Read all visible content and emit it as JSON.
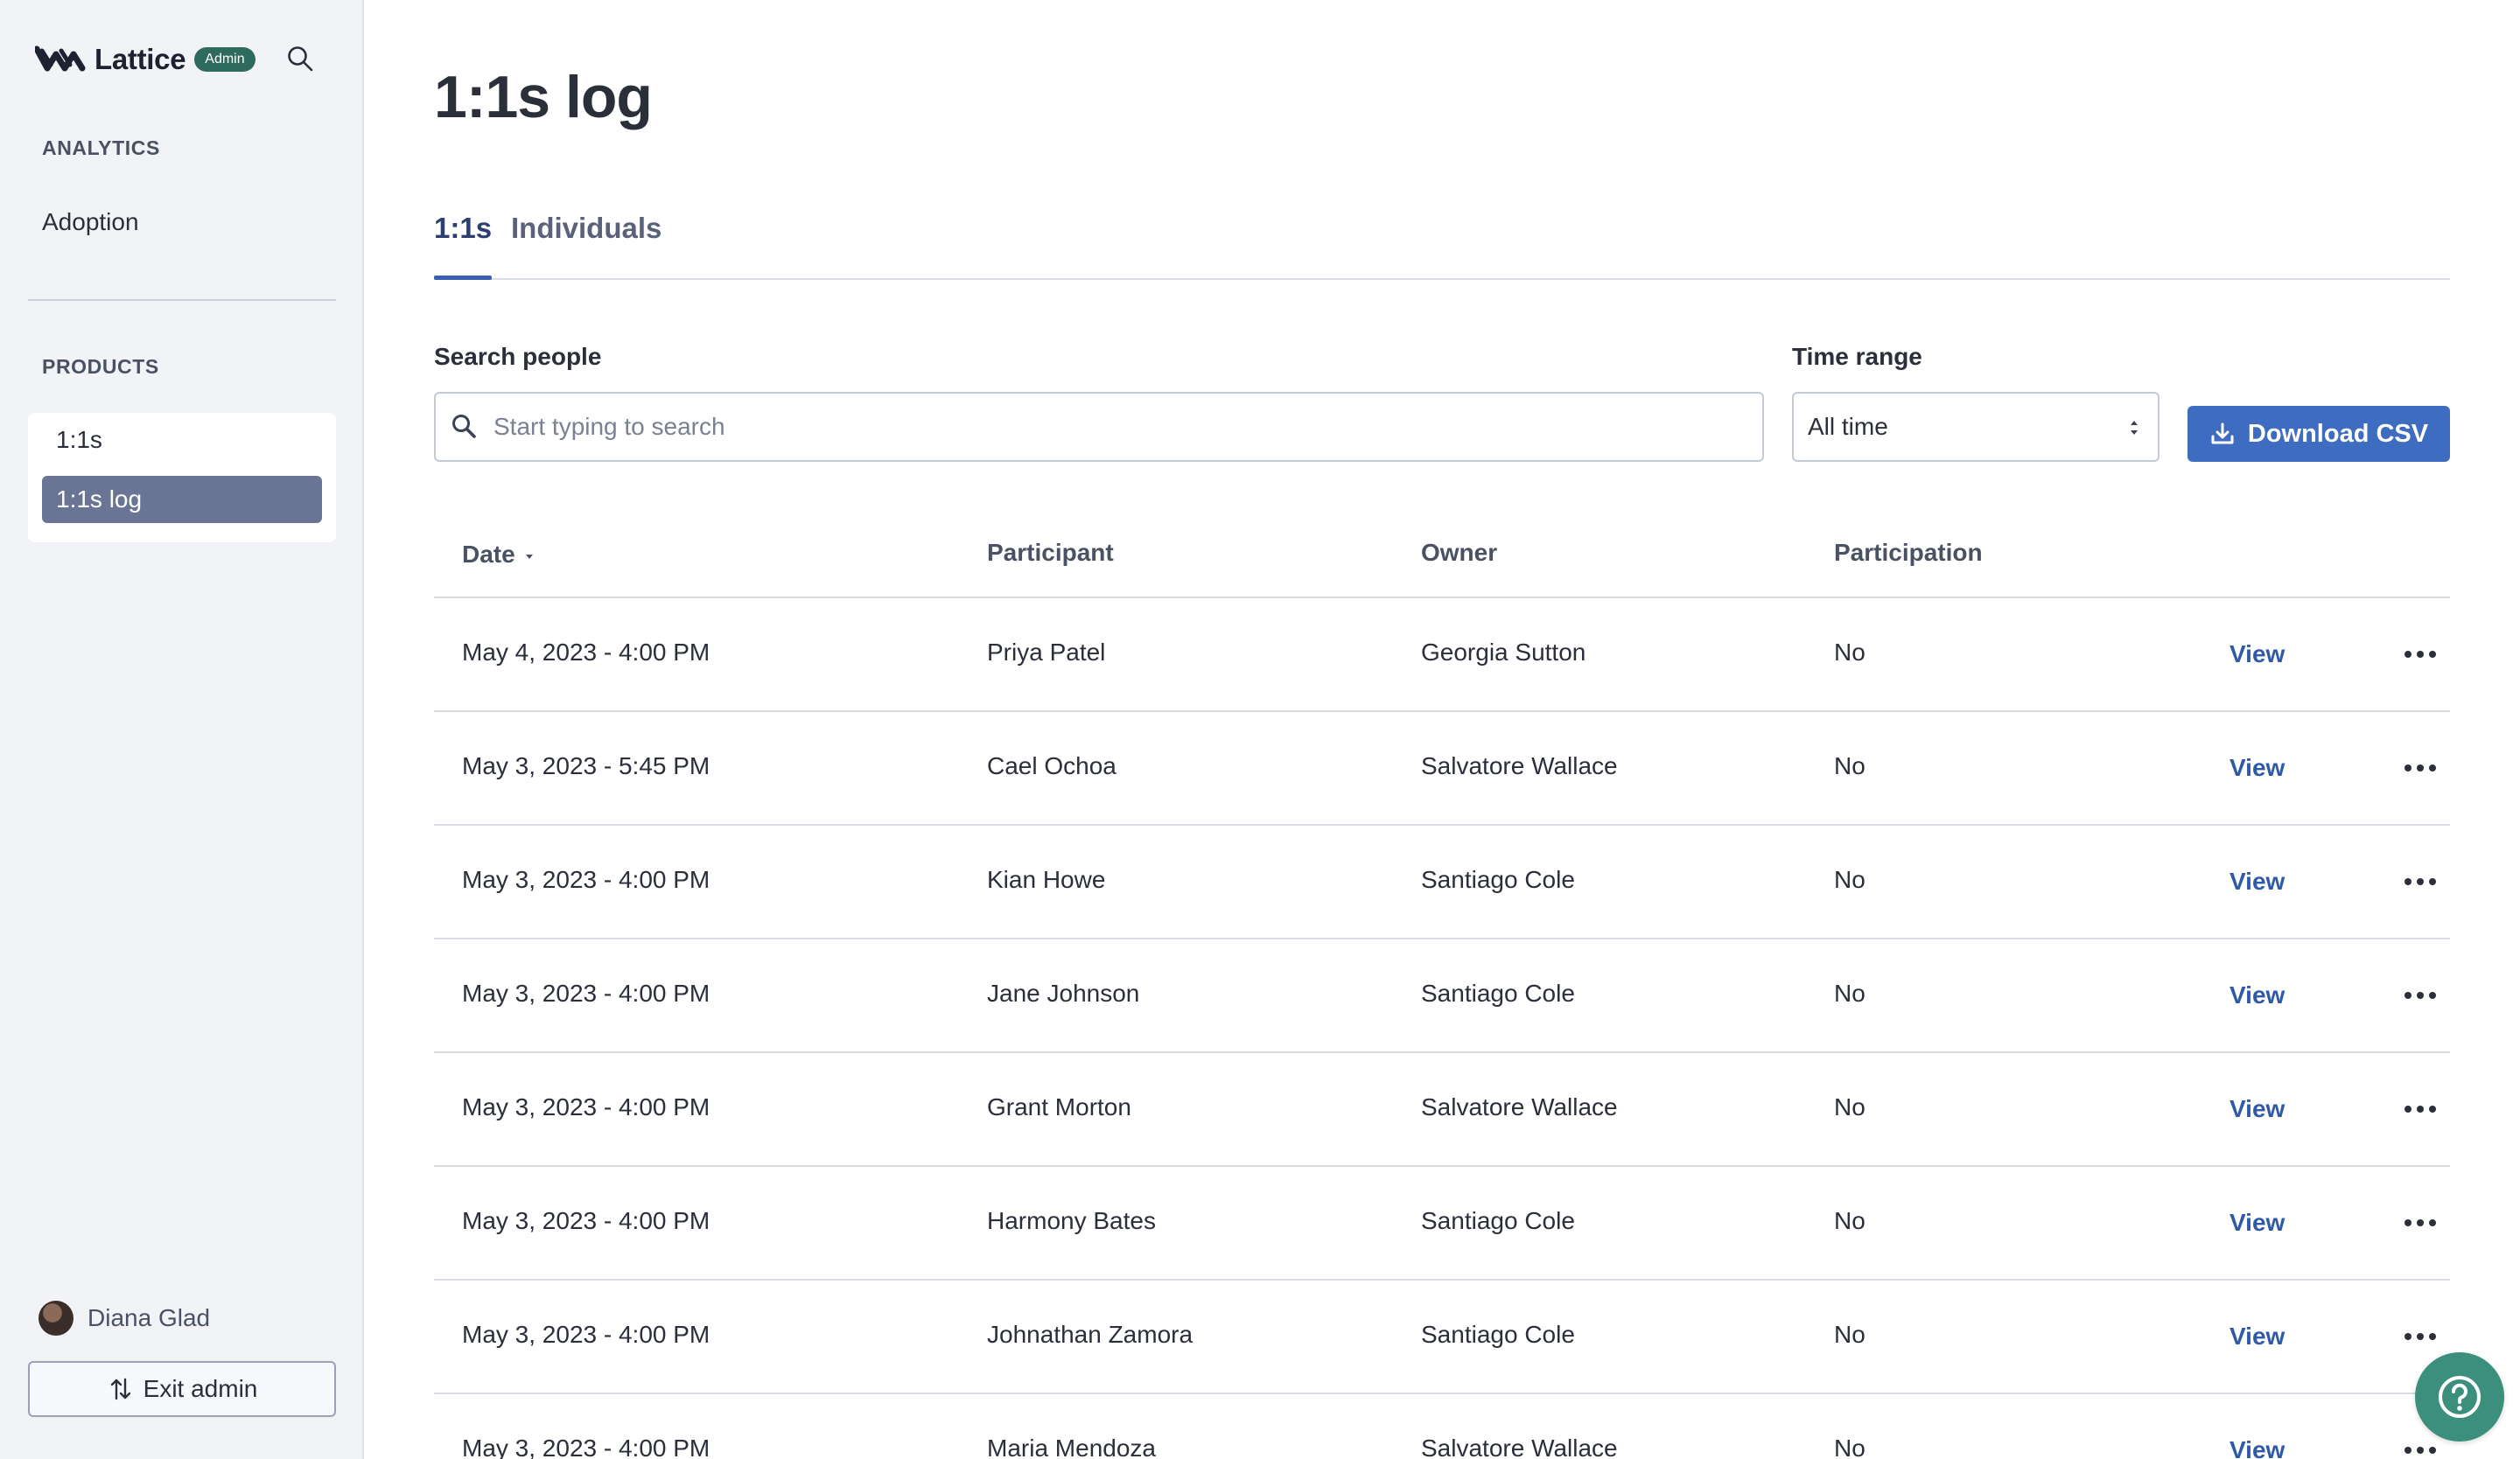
{
  "brand": {
    "name": "Lattice",
    "badge": "Admin"
  },
  "sidebar": {
    "analytics_heading": "ANALYTICS",
    "analytics_items": [
      {
        "label": "Adoption"
      }
    ],
    "products_heading": "PRODUCTS",
    "products_items": [
      {
        "label": "1:1s",
        "active": false
      },
      {
        "label": "1:1s log",
        "active": true
      }
    ],
    "user": {
      "name": "Diana Glad"
    },
    "exit_label": "Exit admin"
  },
  "page": {
    "title": "1:1s log",
    "tabs": [
      {
        "label": "1:1s",
        "active": true
      },
      {
        "label": "Individuals",
        "active": false
      }
    ]
  },
  "filters": {
    "search_label": "Search people",
    "search_placeholder": "Start typing to search",
    "search_value": "",
    "time_label": "Time range",
    "time_value": "All time",
    "download_label": "Download CSV"
  },
  "table": {
    "columns": {
      "date": "Date",
      "participant": "Participant",
      "owner": "Owner",
      "participation": "Participation"
    },
    "view_label": "View",
    "rows": [
      {
        "date": "May 4, 2023 - 4:00 PM",
        "participant": "Priya Patel",
        "owner": "Georgia Sutton",
        "participation": "No"
      },
      {
        "date": "May 3, 2023 - 5:45 PM",
        "participant": "Cael Ochoa",
        "owner": "Salvatore Wallace",
        "participation": "No"
      },
      {
        "date": "May 3, 2023 - 4:00 PM",
        "participant": "Kian Howe",
        "owner": "Santiago Cole",
        "participation": "No"
      },
      {
        "date": "May 3, 2023 - 4:00 PM",
        "participant": "Jane Johnson",
        "owner": "Santiago Cole",
        "participation": "No"
      },
      {
        "date": "May 3, 2023 - 4:00 PM",
        "participant": "Grant Morton",
        "owner": "Salvatore Wallace",
        "participation": "No"
      },
      {
        "date": "May 3, 2023 - 4:00 PM",
        "participant": "Harmony Bates",
        "owner": "Santiago Cole",
        "participation": "No"
      },
      {
        "date": "May 3, 2023 - 4:00 PM",
        "participant": "Johnathan Zamora",
        "owner": "Santiago Cole",
        "participation": "No"
      },
      {
        "date": "May 3, 2023 - 4:00 PM",
        "participant": "Maria Mendoza",
        "owner": "Salvatore Wallace",
        "participation": "No"
      }
    ]
  },
  "colors": {
    "accent": "#3d6cc0",
    "active_nav": "#6a7596",
    "admin_badge": "#2e6b5e",
    "help_button": "#3c8f7d"
  },
  "icons": {
    "brand": "lattice-logo-icon",
    "search": "search-icon",
    "download": "download-icon",
    "exit": "swap-arrows-icon",
    "more": "more-horizontal-icon",
    "help": "help-icon"
  }
}
